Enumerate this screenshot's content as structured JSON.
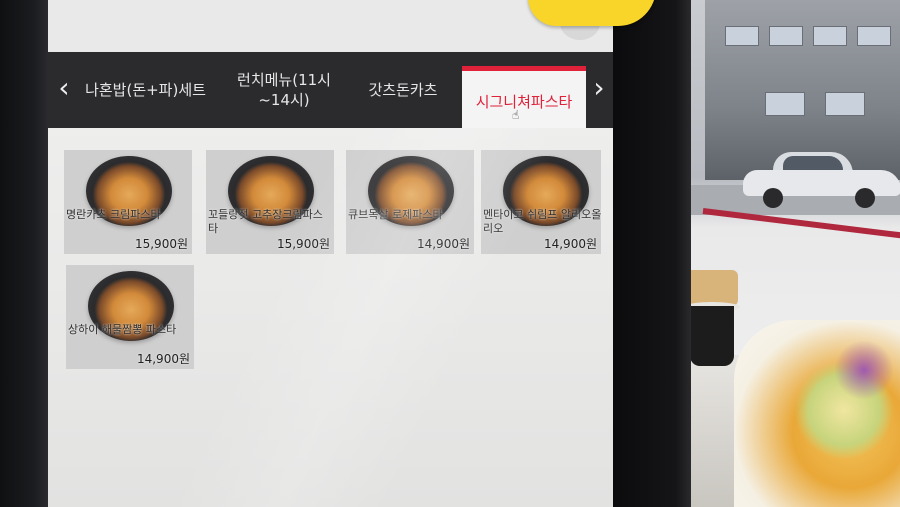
{
  "tabs": {
    "prev_icon": "chevron-left-icon",
    "next_icon": "chevron-right-icon",
    "items": [
      {
        "label": "나혼밥(돈+파)세트"
      },
      {
        "label": "런치메뉴(11시~14시)"
      },
      {
        "label": "갓츠돈카츠"
      },
      {
        "label": "시그니쳐파스타",
        "active": true
      }
    ],
    "active_color": "#e0213a"
  },
  "menu": {
    "items": [
      {
        "name": "명란카츠 크림파스타",
        "price": "15,900원"
      },
      {
        "name": "꼬들랑젓 고추장크림파스타",
        "price": "15,900원"
      },
      {
        "name": "큐브목살 로제파스타",
        "price": "14,900원"
      },
      {
        "name": "멘타이코 쉬림프 알리오올리오",
        "price": "14,900원"
      },
      {
        "name": "상하이 해물짬뽕 파스타",
        "price": "14,900원"
      }
    ]
  }
}
